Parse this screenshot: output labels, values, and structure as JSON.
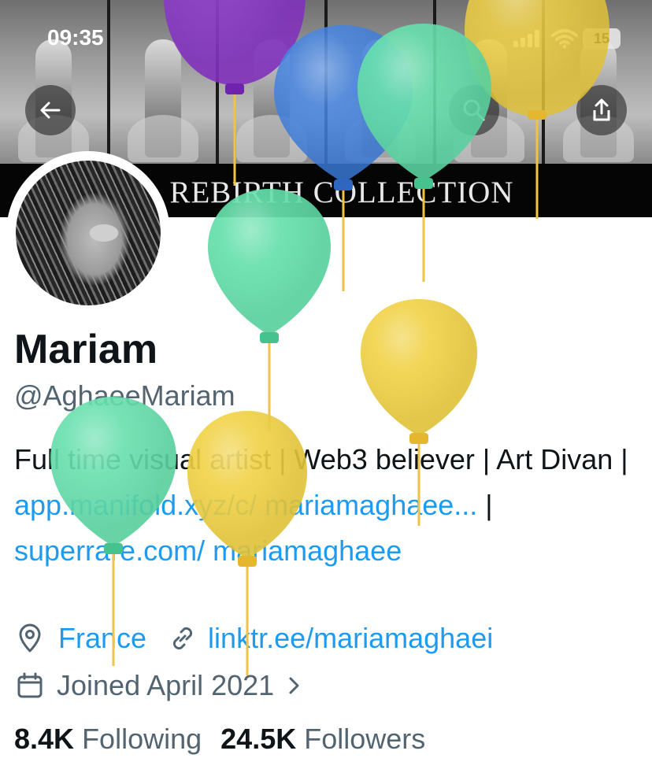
{
  "status_bar": {
    "time": "09:35",
    "battery": "15"
  },
  "banner": {
    "caption": "REBIRTH COLLECTION"
  },
  "header": {
    "back_icon": "arrow-left-icon",
    "search_icon": "search-icon",
    "share_icon": "share-icon"
  },
  "profile": {
    "name": "Mariam",
    "handle": "@AghaeeMariam",
    "bio_text_1": "Full time visual artist | Web3 believer | Art Divan | ",
    "bio_link_1": "app.manifold.xyz/c/ mariamaghaee...",
    "bio_sep": " | ",
    "bio_link_2": "superrare.com/ mariamaghaee",
    "location": "France",
    "website": "linktr.ee/mariamaghaei",
    "joined": "Joined April 2021",
    "following_count": "8.4K",
    "following_label": "Following",
    "followers_count": "24.5K",
    "followers_label": "Followers"
  },
  "colors": {
    "link": "#1d9bf0",
    "secondary_text": "#536471",
    "balloon_purple": "#8a35c9",
    "balloon_blue": "#3d7fe0",
    "balloon_green": "#5fdea8",
    "balloon_yellow": "#f0cf3c"
  }
}
